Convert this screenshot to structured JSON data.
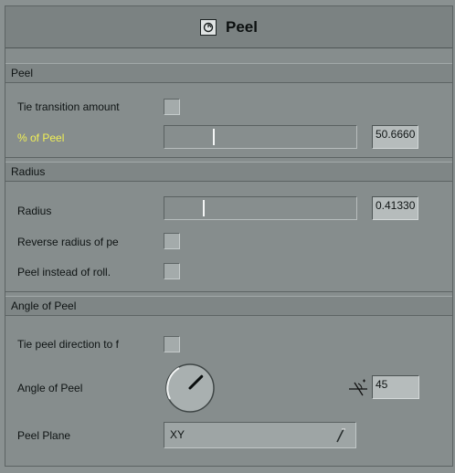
{
  "window": {
    "title": "Peel",
    "icon": "peel-effect-icon"
  },
  "sections": {
    "peel": {
      "header": "Peel",
      "tie_transition_label": "Tie transition amount",
      "tie_transition_checked": false,
      "percent_label": "% of Peel",
      "percent_value": "50.6660",
      "percent_slider_fraction": 0.25
    },
    "radius": {
      "header": "Radius",
      "radius_label": "Radius",
      "radius_value": "0.41330",
      "radius_slider_fraction": 0.2,
      "reverse_label": "Reverse radius of pe",
      "reverse_checked": false,
      "peel_instead_label": "Peel instead of roll.",
      "peel_instead_checked": false
    },
    "angle": {
      "header": "Angle of Peel",
      "tie_direction_label": "Tie peel direction to f",
      "tie_direction_checked": false,
      "angle_label": "Angle of Peel",
      "angle_value": "45",
      "angle_icon": "angle-arrow-icon",
      "plane_label": "Peel Plane",
      "plane_value": "XY"
    }
  },
  "colors": {
    "highlight_label": "#f0ef55",
    "panel": "#868d8d",
    "field": "#b6bcbc"
  }
}
